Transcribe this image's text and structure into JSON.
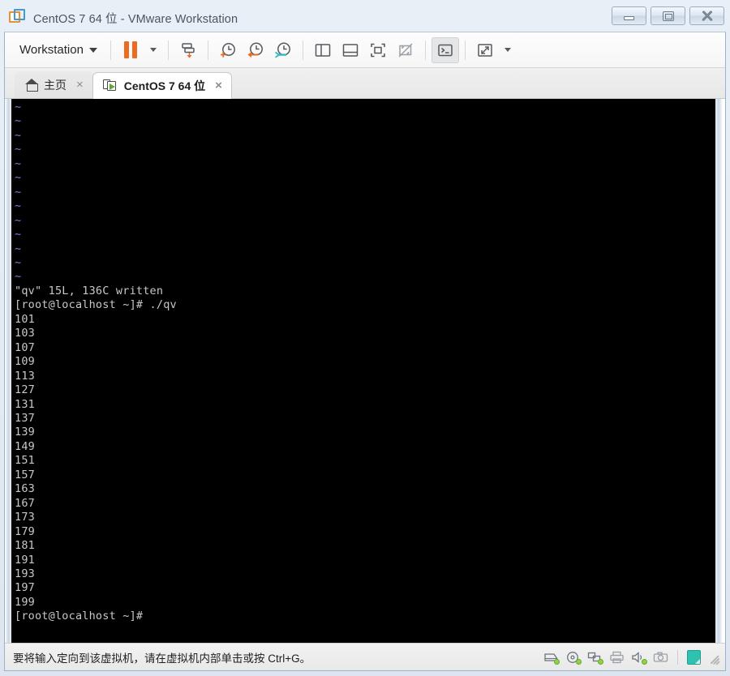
{
  "window": {
    "title": "CentOS 7 64 位 - VMware Workstation",
    "logo_icon": "vmware-logo-icon",
    "minimize_label": "minimize-icon",
    "maximize_label": "restore-icon",
    "close_label": "close-icon"
  },
  "toolbar": {
    "menu_label": "Workstation",
    "menu_caret": "chevron-down-icon",
    "buttons": [
      {
        "name": "suspend-button",
        "icon": "pause-icon"
      },
      {
        "name": "suspend-dropdown",
        "icon": "chevron-down-icon"
      },
      {
        "name": "power-button",
        "icon": "power-off-icon"
      },
      {
        "name": "take-snapshot-button",
        "icon": "snapshot-add-icon"
      },
      {
        "name": "revert-snapshot-button",
        "icon": "snapshot-revert-icon"
      },
      {
        "name": "snapshot-manager-button",
        "icon": "snapshot-manager-icon"
      },
      {
        "name": "show-library-button",
        "icon": "panel-left-icon"
      },
      {
        "name": "show-thumbnails-button",
        "icon": "panel-bottom-icon"
      },
      {
        "name": "fit-guest-button",
        "icon": "fit-screen-icon"
      },
      {
        "name": "fit-window-button",
        "icon": "fit-window-off-icon"
      },
      {
        "name": "console-view-button",
        "icon": "terminal-icon"
      },
      {
        "name": "fullscreen-button",
        "icon": "expand-icon"
      },
      {
        "name": "fullscreen-dropdown",
        "icon": "chevron-down-icon"
      }
    ]
  },
  "tabs": [
    {
      "label": "主页",
      "icon": "home-icon",
      "active": false,
      "close": "×"
    },
    {
      "label": "CentOS 7 64 位",
      "icon": "vm-running-icon",
      "active": true,
      "close": "×"
    }
  ],
  "terminal": {
    "blank_tilde_lines": 13,
    "tilde": "~",
    "lines": [
      "\"qv\" 15L, 136C written",
      "[root@localhost ~]# ./qv",
      "101",
      "103",
      "107",
      "109",
      "113",
      "127",
      "131",
      "137",
      "139",
      "149",
      "151",
      "157",
      "163",
      "167",
      "173",
      "179",
      "181",
      "191",
      "193",
      "197",
      "199",
      "[root@localhost ~]#"
    ]
  },
  "statusbar": {
    "message": "要将输入定向到该虚拟机，请在虚拟机内部单击或按 Ctrl+G。",
    "icons": [
      {
        "name": "hard-disk-icon"
      },
      {
        "name": "cd-dvd-icon"
      },
      {
        "name": "network-adapter-icon"
      },
      {
        "name": "printer-icon"
      },
      {
        "name": "sound-card-icon"
      },
      {
        "name": "camera-icon"
      },
      {
        "name": "note-icon"
      },
      {
        "name": "resize-grip-icon"
      }
    ]
  },
  "colors": {
    "accent_orange": "#ec6b22",
    "accent_blue": "#3f9ad6",
    "accent_teal": "#2fc2b0",
    "status_green": "#8ed63f",
    "terminal_bg": "#000000",
    "terminal_fg": "#c8c8c8"
  }
}
